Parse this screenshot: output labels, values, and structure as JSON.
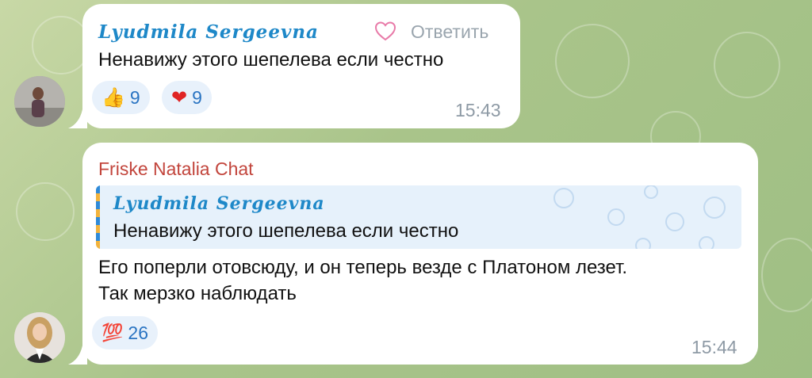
{
  "messages": [
    {
      "sender": "Lyudmila Sergeevna",
      "reply_action": "Ответить",
      "text": "Ненавижу этого шепелева если честно",
      "reactions": [
        {
          "icon": "thumbs-up-icon",
          "emoji": "👍",
          "count": "9"
        },
        {
          "icon": "heart-icon",
          "emoji": "❤",
          "count": "9"
        }
      ],
      "time": "15:43"
    },
    {
      "sender": "Friske Natalia Chat",
      "quote": {
        "sender": "Lyudmila Sergeevna",
        "text": "Ненавижу этого шепелева если честно"
      },
      "text_line1": "Его поперли отовсюду, и он теперь везде с Платоном лезет.",
      "text_line2": "Так мерзко наблюдать",
      "reactions": [
        {
          "icon": "hundred-points-icon",
          "emoji": "💯",
          "count": "26"
        }
      ],
      "time": "15:44"
    }
  ],
  "colors": {
    "accent": "#1e88c8",
    "sender_red": "#c2453c",
    "bubble": "#ffffff",
    "reaction_bg": "#e8f1fb",
    "time": "#8e9aa5"
  }
}
